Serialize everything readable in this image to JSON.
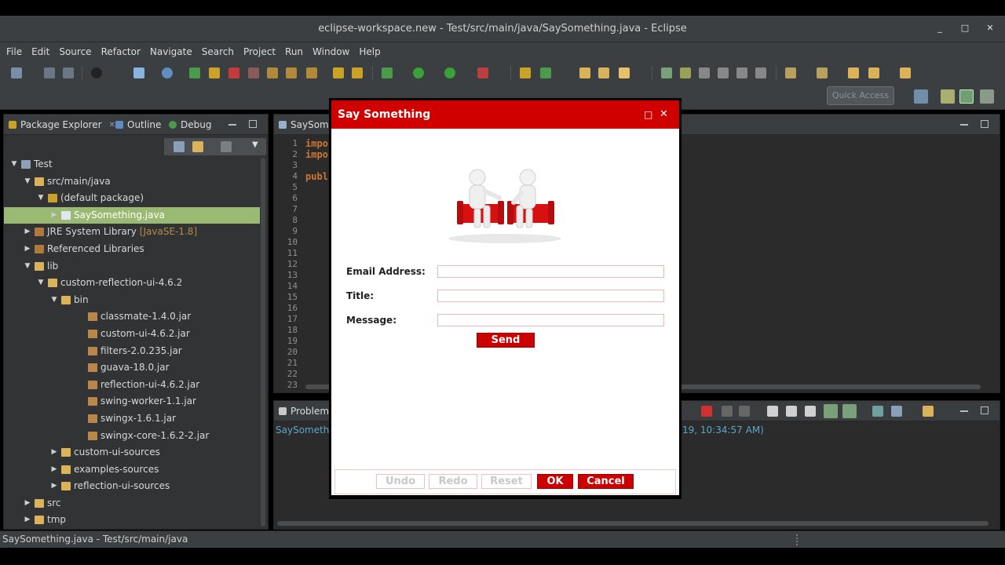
{
  "window": {
    "title": "eclipse-workspace.new - Test/src/main/java/SaySomething.java - Eclipse",
    "controls": [
      "_",
      "□",
      "✕"
    ]
  },
  "menu": [
    "File",
    "Edit",
    "Source",
    "Refactor",
    "Navigate",
    "Search",
    "Project",
    "Run",
    "Window",
    "Help"
  ],
  "toolbar": {
    "quick_access_placeholder": "Quick Access"
  },
  "package_explorer": {
    "tabs": [
      "Package Explorer",
      "Outline",
      "Debug"
    ],
    "tree": [
      {
        "label": "Test",
        "indent": 0,
        "arrow": "▼",
        "icon": "project-icon"
      },
      {
        "label": "src/main/java",
        "indent": 1,
        "arrow": "▼",
        "icon": "source-folder-icon"
      },
      {
        "label": "(default package)",
        "indent": 2,
        "arrow": "▼",
        "icon": "package-icon"
      },
      {
        "label": "SaySomething.java",
        "indent": 3,
        "arrow": "▶",
        "icon": "java-file-icon",
        "selected": true
      },
      {
        "label": "JRE System Library",
        "suffix": "[JavaSE-1.8]",
        "indent": 1,
        "arrow": "▶",
        "icon": "library-icon"
      },
      {
        "label": "Referenced Libraries",
        "indent": 1,
        "arrow": "▶",
        "icon": "library-icon"
      },
      {
        "label": "lib",
        "indent": 1,
        "arrow": "▼",
        "icon": "folder-icon"
      },
      {
        "label": "custom-reflection-ui-4.6.2",
        "indent": 2,
        "arrow": "▼",
        "icon": "folder-icon"
      },
      {
        "label": "bin",
        "indent": 3,
        "arrow": "▼",
        "icon": "folder-icon"
      },
      {
        "label": "classmate-1.4.0.jar",
        "indent": 5,
        "arrow": "",
        "icon": "jar-icon"
      },
      {
        "label": "custom-ui-4.6.2.jar",
        "indent": 5,
        "arrow": "",
        "icon": "jar-icon"
      },
      {
        "label": "filters-2.0.235.jar",
        "indent": 5,
        "arrow": "",
        "icon": "jar-icon"
      },
      {
        "label": "guava-18.0.jar",
        "indent": 5,
        "arrow": "",
        "icon": "jar-icon"
      },
      {
        "label": "reflection-ui-4.6.2.jar",
        "indent": 5,
        "arrow": "",
        "icon": "jar-icon"
      },
      {
        "label": "swing-worker-1.1.jar",
        "indent": 5,
        "arrow": "",
        "icon": "jar-icon"
      },
      {
        "label": "swingx-1.6.1.jar",
        "indent": 5,
        "arrow": "",
        "icon": "jar-icon"
      },
      {
        "label": "swingx-core-1.6.2-2.jar",
        "indent": 5,
        "arrow": "",
        "icon": "jar-icon"
      },
      {
        "label": "custom-ui-sources",
        "indent": 3,
        "arrow": "▶",
        "icon": "folder-icon"
      },
      {
        "label": "examples-sources",
        "indent": 3,
        "arrow": "▶",
        "icon": "folder-icon"
      },
      {
        "label": "reflection-ui-sources",
        "indent": 3,
        "arrow": "▶",
        "icon": "folder-icon"
      },
      {
        "label": "src",
        "indent": 1,
        "arrow": "▶",
        "icon": "folder-icon"
      },
      {
        "label": "tmp",
        "indent": 1,
        "arrow": "▶",
        "icon": "folder-icon"
      }
    ]
  },
  "editor": {
    "tab": "SaySome",
    "line_numbers": [
      "1",
      "2",
      "3",
      "4",
      "5",
      "6",
      "7",
      "8",
      "9",
      "10",
      "11",
      "12",
      "13",
      "14",
      "15",
      "16",
      "17",
      "18",
      "19",
      "20",
      "21",
      "22",
      "23"
    ],
    "code": [
      "impo",
      "impo",
      "",
      "publ"
    ]
  },
  "problems": {
    "tab": "Problem",
    "row_left": "SaySomethir",
    "row_right": "19, 10:34:57 AM)"
  },
  "statusbar": {
    "text": "SaySomething.java - Test/src/main/java"
  },
  "dialog": {
    "title": "Say Something",
    "fields": [
      {
        "label": "Email Address:",
        "value": ""
      },
      {
        "label": "Title:",
        "value": ""
      },
      {
        "label": "Message:",
        "value": ""
      }
    ],
    "send_label": "Send",
    "buttons": {
      "undo": "Undo",
      "redo": "Redo",
      "reset": "Reset",
      "ok": "OK",
      "cancel": "Cancel"
    }
  },
  "colors": {
    "accent_red": "#d00000",
    "selection_green": "#9ab973",
    "ide_bg": "#2b2b2b",
    "chrome_bg": "#3c3f41"
  }
}
